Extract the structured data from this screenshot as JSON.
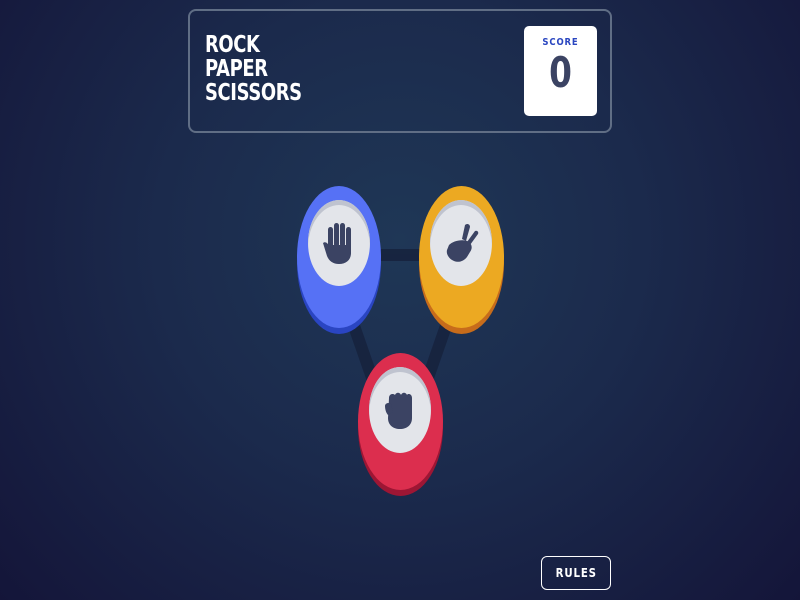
{
  "header": {
    "title_lines": [
      "ROCK",
      "PAPER",
      "SCISSORS"
    ],
    "score_label": "SCORE",
    "score_value": "0"
  },
  "choices": [
    {
      "name": "paper",
      "icon": "paper-hand-icon",
      "color": "#5671f5",
      "shadow": "#2a45c2"
    },
    {
      "name": "scissors",
      "icon": "scissors-hand-icon",
      "color": "#eca922",
      "shadow": "#c76c1b"
    },
    {
      "name": "rock",
      "icon": "rock-hand-icon",
      "color": "#dc2e4e",
      "shadow": "#9d1634"
    }
  ],
  "rules_button": {
    "label": "RULES"
  },
  "colors": {
    "background": "#1f3756",
    "hand": "#3b4363",
    "header_border": "#606e85",
    "score_label": "#2a46c0"
  }
}
